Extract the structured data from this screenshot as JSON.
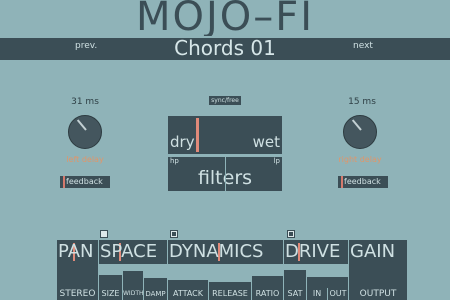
{
  "app": {
    "title": "MOJO–FI"
  },
  "preset": {
    "name": "Chords 01",
    "prev": "prev.",
    "next": "next"
  },
  "delay": {
    "left": {
      "time": "31 ms",
      "label": "left delay",
      "feedback": "feedback"
    },
    "right": {
      "time": "15 ms",
      "label": "right delay",
      "feedback": "feedback"
    }
  },
  "sync": "sync/free",
  "mix": {
    "dry": "dry",
    "wet": "wet",
    "value": 0.25
  },
  "filters": {
    "title": "filters",
    "hp": "hp",
    "lp": "lp"
  },
  "sections": {
    "pan": "PAN",
    "space": "SPACE",
    "dynamics": "DYNAMICS",
    "drive": "DRIVE",
    "gain": "GAIN"
  },
  "params": {
    "stereo": "STEREO",
    "size": "SIZE",
    "width": "WIDTH",
    "damp": "DAMP",
    "attack": "ATTACK",
    "release": "RELEASE",
    "ratio": "RATIO",
    "sat": "SAT",
    "in": "IN",
    "out": "OUT",
    "output": "OUTPUT"
  },
  "colors": {
    "bg": "#8fb3b8",
    "panel": "#3b4e56",
    "accent": "#e08a7a",
    "label": "#e0966a"
  }
}
